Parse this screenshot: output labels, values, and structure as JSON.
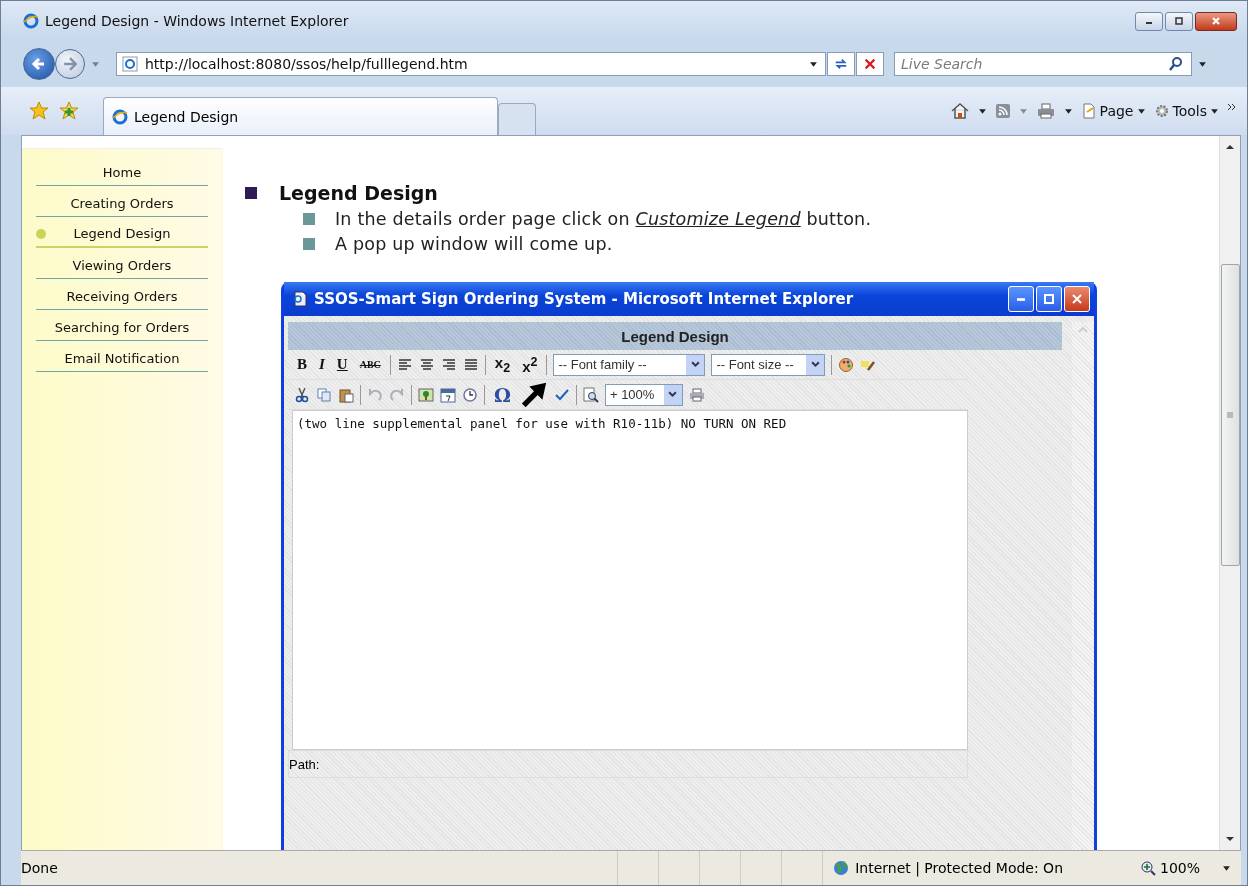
{
  "window": {
    "title": "Legend Design - Windows Internet Explorer"
  },
  "address_bar": {
    "url": "http://localhost:8080/ssos/help/fulllegend.htm",
    "search_placeholder": "Live Search"
  },
  "tabs": [
    {
      "label": "Legend Design",
      "selected": true
    },
    {
      "selected": false
    }
  ],
  "command_bar": [
    "Page",
    "Tools"
  ],
  "sidebar": {
    "items": [
      {
        "label": "Home",
        "selected": false
      },
      {
        "label": "Creating Orders",
        "selected": false
      },
      {
        "label": "Legend Design",
        "selected": true
      },
      {
        "label": "Viewing Orders",
        "selected": false
      },
      {
        "label": "Receiving Orders",
        "selected": false
      },
      {
        "label": "Searching for Orders",
        "selected": false
      },
      {
        "label": "Email Notification",
        "selected": false
      }
    ]
  },
  "content": {
    "heading": "Legend Design",
    "bullets": [
      {
        "before": "In the details order page click on ",
        "link": "Customize Legend",
        "after": " button."
      },
      {
        "before": "A pop up window will come up."
      }
    ]
  },
  "popup": {
    "title": "SSOS-Smart Sign Ordering System - Microsoft Internet Explorer",
    "header": "Legend Design",
    "format_buttons": [
      "B",
      "I",
      "U",
      "ABC"
    ],
    "script_buttons": [
      "x$_{2}$",
      "x$^{2}$"
    ],
    "font_family": "-- Font family --",
    "font_size": "-- Font size --",
    "special_char": "Ω",
    "zoom": "+ 100%",
    "editor_text": "(two line supplemental panel for use with R10-11b) NO TURN ON RED",
    "path_label": "Path:"
  },
  "status_bar": {
    "text": "Done",
    "zone": "Internet | Protected Mode: On",
    "zoom": "100%"
  }
}
